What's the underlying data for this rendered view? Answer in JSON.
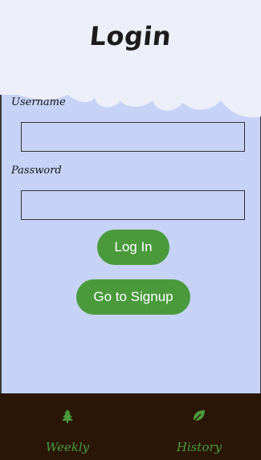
{
  "header": {
    "title": "Login"
  },
  "form": {
    "username_label": "Username",
    "username_value": "",
    "password_label": "Password",
    "password_value": "",
    "login_button": "Log In",
    "signup_button": "Go to Signup"
  },
  "nav": {
    "items": [
      {
        "label": "Weekly",
        "icon": "tree-icon"
      },
      {
        "label": "History",
        "icon": "leaf-icon"
      }
    ]
  },
  "colors": {
    "background": "#c6d3f7",
    "header_background": "#eceff8",
    "button": "#4a9a3c",
    "nav_background": "#2a1606",
    "nav_text": "#4a9a3c"
  }
}
